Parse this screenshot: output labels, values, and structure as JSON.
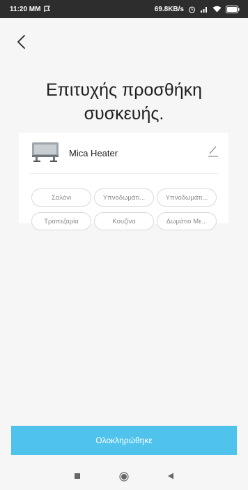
{
  "status_bar": {
    "time": "11:20 MM",
    "network_speed": "69.8KB/s"
  },
  "page": {
    "title_line1": "Επιτυχής προσθήκη",
    "title_line2": "συσκευής."
  },
  "device": {
    "name": "Mica Heater",
    "icon": "heater-icon"
  },
  "rooms": [
    {
      "label": "Σαλόνι"
    },
    {
      "label": "Υπνοδωμάτι..."
    },
    {
      "label": "Υπνοδωμάτι..."
    },
    {
      "label": "Τραπεζαρία"
    },
    {
      "label": "Κουζίνα"
    },
    {
      "label": "Δωμάτιο Με..."
    }
  ],
  "actions": {
    "done_label": "Ολοκληρώθηκε"
  },
  "nav": {
    "icons": [
      "square-recents-icon",
      "circle-home-icon",
      "triangle-back-icon"
    ]
  },
  "colors": {
    "accent": "#4fc3ec",
    "status_bar": "#2d2d2d",
    "background": "#f6f6f6"
  }
}
